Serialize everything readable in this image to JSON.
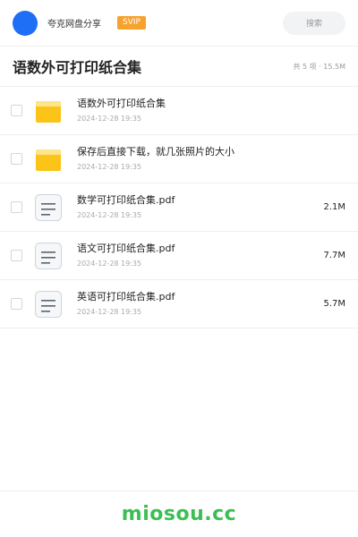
{
  "header": {
    "username": "夸克网盘分享",
    "vip_badge": "SVIP",
    "search_placeholder": "搜索"
  },
  "folder": {
    "title": "语数外可打印纸合集",
    "summary": "共 5 项 · 15.5M"
  },
  "files": [
    {
      "name": "语数外可打印纸合集",
      "date": "2024-12-28 19:35",
      "size": "",
      "type": "folder"
    },
    {
      "name": "保存后直接下载，就几张照片的大小",
      "date": "2024-12-28 19:35",
      "size": "",
      "type": "folder"
    },
    {
      "name": "数学可打印纸合集.pdf",
      "date": "2024-12-28 19:35",
      "size": "2.1M",
      "type": "document"
    },
    {
      "name": "语文可打印纸合集.pdf",
      "date": "2024-12-28 19:35",
      "size": "7.7M",
      "type": "document"
    },
    {
      "name": "英语可打印纸合集.pdf",
      "date": "2024-12-28 19:35",
      "size": "5.7M",
      "type": "document"
    }
  ],
  "footer": {
    "brand": "miosou.cc"
  },
  "colors": {
    "avatar": "#1e6ff5",
    "vip": "#f7a22d",
    "folder": "#fcc419",
    "brand": "#3cbf52"
  }
}
